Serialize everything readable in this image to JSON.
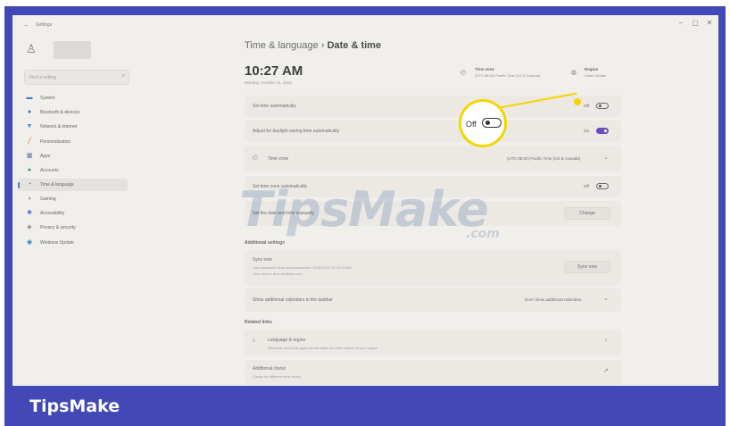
{
  "window": {
    "title": "Settings",
    "back_glyph": "←",
    "controls": [
      "–",
      "▢",
      "✕"
    ]
  },
  "sidebar": {
    "search_placeholder": "Find a setting",
    "items": [
      {
        "label": "System",
        "icon": "monitor-icon",
        "color": "#3a7bd5",
        "active": false
      },
      {
        "label": "Bluetooth & devices",
        "icon": "bluetooth-icon",
        "color": "#1f6fd1",
        "active": false
      },
      {
        "label": "Network & internet",
        "icon": "wifi-icon",
        "color": "#3a7bd5",
        "active": false
      },
      {
        "label": "Personalization",
        "icon": "brush-icon",
        "color": "#c86a3c",
        "active": false
      },
      {
        "label": "Apps",
        "icon": "apps-icon",
        "color": "#5c6f9e",
        "active": false
      },
      {
        "label": "Accounts",
        "icon": "person-icon",
        "color": "#2e9b6a",
        "active": false
      },
      {
        "label": "Time & language",
        "icon": "globe-clock-icon",
        "color": "#2d7bc9",
        "active": true
      },
      {
        "label": "Gaming",
        "icon": "gamepad-icon",
        "color": "#7a7a7a",
        "active": false
      },
      {
        "label": "Accessibility",
        "icon": "accessibility-icon",
        "color": "#3a7bd5",
        "active": false
      },
      {
        "label": "Privacy & security",
        "icon": "shield-icon",
        "color": "#7a7a7a",
        "active": false
      },
      {
        "label": "Windows Update",
        "icon": "update-icon",
        "color": "#2d7bc9",
        "active": false
      }
    ]
  },
  "header": {
    "breadcrumb_parent": "Time & language",
    "breadcrumb_sep": "›",
    "breadcrumb_current": "Date & time",
    "time": "10:27 AM",
    "date": "Monday, October 31, 2022",
    "timezone_heading": "Time zone",
    "timezone_value": "(UTC-08:00) Pacific Time (US & Canada)",
    "region_heading": "Region",
    "region_value": "United States"
  },
  "settings": {
    "set_time_auto": {
      "label": "Set time automatically",
      "state": "Off",
      "on": false
    },
    "dst": {
      "label": "Adjust for daylight saving time automatically",
      "state": "On",
      "on": true
    },
    "timezone": {
      "label": "Time zone",
      "value": "(UTC-08:00) Pacific Time (US & Canada)"
    },
    "set_tz_auto": {
      "label": "Set time zone automatically",
      "state": "Off",
      "on": false
    },
    "manual": {
      "label": "Set the date and time manually",
      "button": "Change"
    },
    "additional_heading": "Additional settings",
    "sync": {
      "label": "Sync now",
      "last": "Last successful time synchronization: 10/31/2022 10:23:43 AM",
      "server": "Time server: time.windows.com",
      "button": "Sync now"
    },
    "calendars": {
      "label": "Show additional calendars in the taskbar",
      "value": "Don't show additional calendars"
    },
    "related_heading": "Related links",
    "lang_region": {
      "label": "Language & region",
      "sub": "Windows and some apps format dates and time based on your region"
    },
    "clocks": {
      "label": "Additional clocks",
      "sub": "Clocks for different time zones"
    }
  },
  "callout": {
    "label": "Off"
  },
  "watermark": {
    "main": "TipsMake",
    "suffix": ".com"
  },
  "footer": {
    "brand": "TipsMake"
  },
  "colors": {
    "frame": "#4248b5",
    "accent": "#6b4fb8",
    "highlight": "#f3d600"
  }
}
